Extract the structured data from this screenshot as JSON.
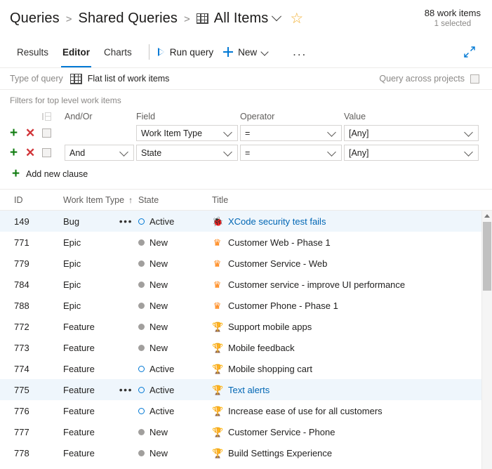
{
  "header": {
    "breadcrumb": [
      {
        "label": "Queries",
        "icon": null
      },
      {
        "label": "Shared Queries",
        "icon": null
      },
      {
        "label": "All Items",
        "icon": "grid-icon"
      }
    ],
    "separator": ">",
    "favorite_icon": "star-icon",
    "count_main": "88 work items",
    "count_sub": "1 selected"
  },
  "toolbar": {
    "tabs": [
      {
        "label": "Results",
        "active": false
      },
      {
        "label": "Editor",
        "active": true
      },
      {
        "label": "Charts",
        "active": false
      }
    ],
    "run_query_label": "Run query",
    "new_label": "New",
    "more_label": "...",
    "expand_icon": "full-screen-icon"
  },
  "editor": {
    "type_of_query_label": "Type of query",
    "type_of_query_value": "Flat list of work items",
    "query_across_projects_label": "Query across projects",
    "query_across_projects_checked": false,
    "filters_label": "Filters for top level work items",
    "columns": {
      "group": "group-clauses-icon",
      "andor": "And/Or",
      "field": "Field",
      "operator": "Operator",
      "value": "Value"
    },
    "add_new_clause_label": "Add new clause",
    "clauses": [
      {
        "andor": "",
        "field": "Work Item Type",
        "operator": "=",
        "value": "[Any]",
        "checked": false
      },
      {
        "andor": "And",
        "field": "State",
        "operator": "=",
        "value": "[Any]",
        "checked": false
      }
    ]
  },
  "grid": {
    "columns": [
      {
        "label": "ID",
        "sorted": false
      },
      {
        "label": "Work Item Type",
        "sorted": true,
        "sort_arrow": "↑"
      },
      {
        "label": "State",
        "sorted": false
      },
      {
        "label": "Title",
        "sorted": false
      }
    ],
    "rows": [
      {
        "id": "149",
        "type": "Bug",
        "type_icon": "bug-icon",
        "state": "Active",
        "state_style": "active",
        "title": "XCode security test fails",
        "selected": true,
        "menu": true
      },
      {
        "id": "771",
        "type": "Epic",
        "type_icon": "crown-icon",
        "state": "New",
        "state_style": "new",
        "title": "Customer Web - Phase 1",
        "selected": false,
        "menu": false
      },
      {
        "id": "779",
        "type": "Epic",
        "type_icon": "crown-icon",
        "state": "New",
        "state_style": "new",
        "title": "Customer Service - Web",
        "selected": false,
        "menu": false
      },
      {
        "id": "784",
        "type": "Epic",
        "type_icon": "crown-icon",
        "state": "New",
        "state_style": "new",
        "title": "Customer service - improve UI performance",
        "selected": false,
        "menu": false
      },
      {
        "id": "788",
        "type": "Epic",
        "type_icon": "crown-icon",
        "state": "New",
        "state_style": "new",
        "title": "Customer Phone - Phase 1",
        "selected": false,
        "menu": false
      },
      {
        "id": "772",
        "type": "Feature",
        "type_icon": "trophy-icon",
        "state": "New",
        "state_style": "new",
        "title": "Support mobile apps",
        "selected": false,
        "menu": false
      },
      {
        "id": "773",
        "type": "Feature",
        "type_icon": "trophy-icon",
        "state": "New",
        "state_style": "new",
        "title": "Mobile feedback",
        "selected": false,
        "menu": false
      },
      {
        "id": "774",
        "type": "Feature",
        "type_icon": "trophy-icon",
        "state": "Active",
        "state_style": "active",
        "title": "Mobile shopping cart",
        "selected": false,
        "menu": false
      },
      {
        "id": "775",
        "type": "Feature",
        "type_icon": "trophy-icon",
        "state": "Active",
        "state_style": "active",
        "title": "Text alerts",
        "selected": true,
        "menu": true
      },
      {
        "id": "776",
        "type": "Feature",
        "type_icon": "trophy-icon",
        "state": "Active",
        "state_style": "active",
        "title": "Increase ease of use for all customers",
        "selected": false,
        "menu": false
      },
      {
        "id": "777",
        "type": "Feature",
        "type_icon": "trophy-icon",
        "state": "New",
        "state_style": "new",
        "title": "Customer Service - Phone",
        "selected": false,
        "menu": false
      },
      {
        "id": "778",
        "type": "Feature",
        "type_icon": "trophy-icon",
        "state": "New",
        "state_style": "new",
        "title": "Build Settings Experience",
        "selected": false,
        "menu": false
      }
    ]
  },
  "icons": {
    "bug": "🐞",
    "crown": "♛",
    "trophy": "🏆",
    "star": "☆",
    "plus": "+",
    "cross": "✕"
  },
  "colors": {
    "accent": "#0078d4",
    "bug": "#cc293d",
    "epic": "#ff7b00",
    "feature": "#773b93",
    "add": "#107c10",
    "delete": "#d13438",
    "favorite": "#f2b134",
    "selected_row": "#eff6fc"
  }
}
